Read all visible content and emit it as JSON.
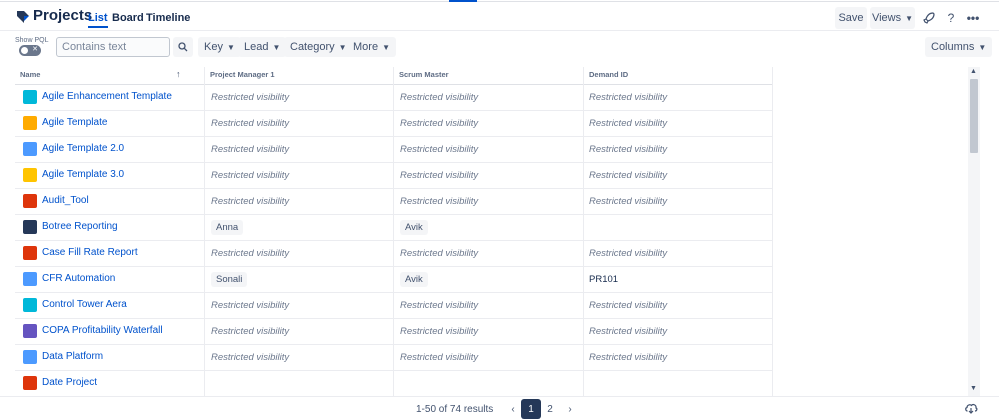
{
  "header": {
    "title": "Projects",
    "tabs": [
      {
        "label": "List",
        "active": true
      },
      {
        "label": "Board",
        "active": false
      },
      {
        "label": "Timeline",
        "active": false
      }
    ],
    "save_label": "Save",
    "views_label": "Views",
    "icons": [
      "rocket-icon",
      "help-icon",
      "more-icon"
    ]
  },
  "filters": {
    "pql_label": "Show PQL",
    "search_placeholder": "Contains text",
    "buttons": [
      "Key",
      "Lead",
      "Category",
      "More"
    ],
    "columns_label": "Columns"
  },
  "table": {
    "headers": [
      "Name",
      "Project Manager 1",
      "Scrum Master",
      "Demand ID"
    ],
    "rows": [
      {
        "name": "Agile Enhancement Template",
        "icon_color": "#00b8d9",
        "pm": "Restricted visibility",
        "sm": "Restricted visibility",
        "demand": "Restricted visibility",
        "pm_type": "restricted",
        "sm_type": "restricted",
        "demand_type": "restricted"
      },
      {
        "name": "Agile Template",
        "icon_color": "#ffab00",
        "pm": "Restricted visibility",
        "sm": "Restricted visibility",
        "demand": "Restricted visibility",
        "pm_type": "restricted",
        "sm_type": "restricted",
        "demand_type": "restricted"
      },
      {
        "name": "Agile Template 2.0",
        "icon_color": "#4c9aff",
        "pm": "Restricted visibility",
        "sm": "Restricted visibility",
        "demand": "Restricted visibility",
        "pm_type": "restricted",
        "sm_type": "restricted",
        "demand_type": "restricted"
      },
      {
        "name": "Agile Template 3.0",
        "icon_color": "#ffc400",
        "pm": "Restricted visibility",
        "sm": "Restricted visibility",
        "demand": "Restricted visibility",
        "pm_type": "restricted",
        "sm_type": "restricted",
        "demand_type": "restricted"
      },
      {
        "name": "Audit_Tool",
        "icon_color": "#de350b",
        "pm": "Restricted visibility",
        "sm": "Restricted visibility",
        "demand": "Restricted visibility",
        "pm_type": "restricted",
        "sm_type": "restricted",
        "demand_type": "restricted"
      },
      {
        "name": "Botree Reporting",
        "icon_color": "#253858",
        "pm": "Anna",
        "sm": "Avik",
        "demand": "",
        "pm_type": "chip",
        "sm_type": "chip",
        "demand_type": "plain"
      },
      {
        "name": "Case Fill Rate Report",
        "icon_color": "#de350b",
        "pm": "Restricted visibility",
        "sm": "Restricted visibility",
        "demand": "Restricted visibility",
        "pm_type": "restricted",
        "sm_type": "restricted",
        "demand_type": "restricted"
      },
      {
        "name": "CFR Automation",
        "icon_color": "#4c9aff",
        "pm": "Sonali",
        "sm": "Avik",
        "demand": "PR101",
        "pm_type": "chip",
        "sm_type": "chip",
        "demand_type": "plain"
      },
      {
        "name": "Control Tower Aera",
        "icon_color": "#00b8d9",
        "pm": "Restricted visibility",
        "sm": "Restricted visibility",
        "demand": "Restricted visibility",
        "pm_type": "restricted",
        "sm_type": "restricted",
        "demand_type": "restricted"
      },
      {
        "name": "COPA Profitability Waterfall",
        "icon_color": "#6554c0",
        "pm": "Restricted visibility",
        "sm": "Restricted visibility",
        "demand": "Restricted visibility",
        "pm_type": "restricted",
        "sm_type": "restricted",
        "demand_type": "restricted"
      },
      {
        "name": "Data Platform",
        "icon_color": "#4c9aff",
        "pm": "Restricted visibility",
        "sm": "Restricted visibility",
        "demand": "Restricted visibility",
        "pm_type": "restricted",
        "sm_type": "restricted",
        "demand_type": "restricted"
      },
      {
        "name": "Date Project",
        "icon_color": "#de350b",
        "pm": "",
        "sm": "",
        "demand": "",
        "pm_type": "plain",
        "sm_type": "plain",
        "demand_type": "plain"
      }
    ]
  },
  "footer": {
    "results": "1-50 of 74 results",
    "pages": [
      "1",
      "2"
    ],
    "current_page": "1"
  }
}
